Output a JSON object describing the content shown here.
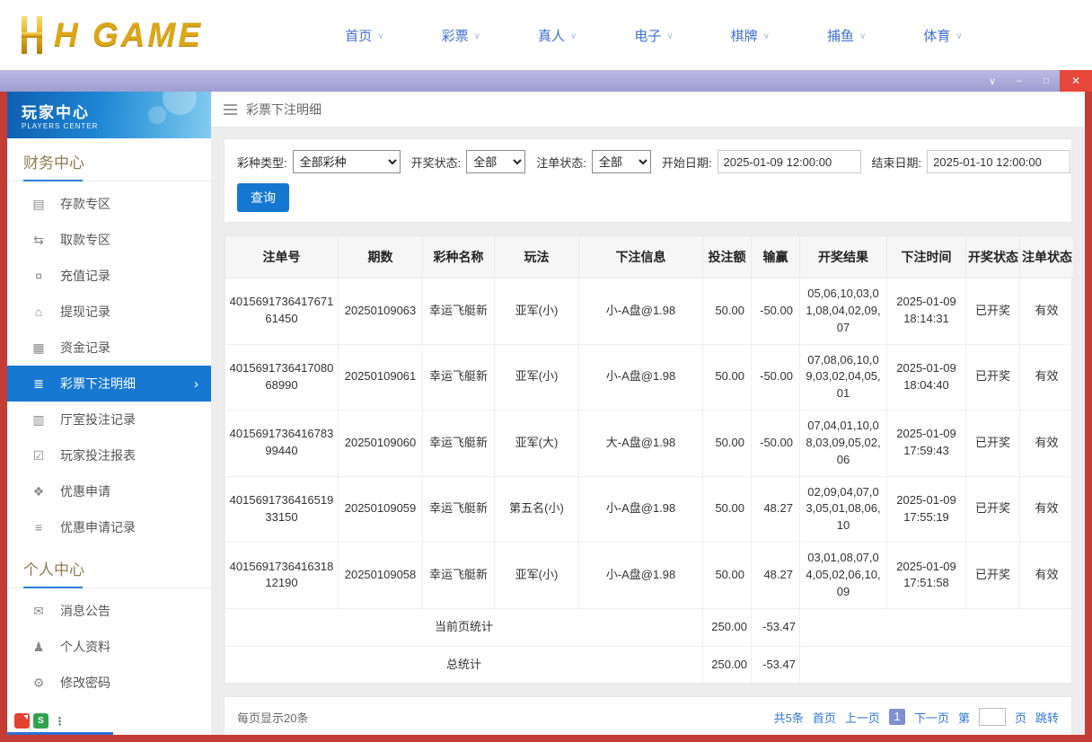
{
  "colors": {
    "accent_blue": "#1677d2",
    "nav_blue": "#3f6fd1",
    "frame_red": "#c43d35",
    "titlebar_lavender": "#aeacd9",
    "close_red": "#e8473b",
    "gold": "#dca619",
    "sidebar_active_blue": "#1778d1"
  },
  "brand": {
    "logo_text": "H GAME"
  },
  "nav": {
    "chevron_glyph": "∨",
    "items": [
      {
        "label": "首页"
      },
      {
        "label": "彩票"
      },
      {
        "label": "真人"
      },
      {
        "label": "电子"
      },
      {
        "label": "棋牌"
      },
      {
        "label": "捕鱼"
      },
      {
        "label": "体育"
      }
    ]
  },
  "titlebar": {
    "controls": [
      {
        "name": "collapse-button",
        "glyph": "∨"
      },
      {
        "name": "minimize-button",
        "glyph": "–"
      },
      {
        "name": "maximize-button",
        "glyph": "□"
      },
      {
        "name": "close-button",
        "glyph": "✕"
      }
    ]
  },
  "sidebar": {
    "title": "玩家中心",
    "subtitle": "PLAYERS CENTER",
    "active_chevron": "›",
    "pinned": {
      "s_glyph": "S",
      "more_glyph": "⋮"
    },
    "sections": [
      {
        "title": "财务中心",
        "items": [
          {
            "label": "存款专区",
            "icon": "▤",
            "icon_name": "deposit-icon"
          },
          {
            "label": "取款专区",
            "icon": "⇆",
            "icon_name": "withdraw-icon"
          },
          {
            "label": "充值记录",
            "icon": "¤",
            "icon_name": "recharge-record-icon"
          },
          {
            "label": "提现记录",
            "icon": "⌂",
            "icon_name": "withdrawal-record-icon"
          },
          {
            "label": "资金记录",
            "icon": "▦",
            "icon_name": "funds-record-icon"
          },
          {
            "label": "彩票下注明细",
            "icon": "≣",
            "icon_name": "lottery-bet-details-icon",
            "active": true
          },
          {
            "label": "厅室投注记录",
            "icon": "▥",
            "icon_name": "hall-bet-record-icon"
          },
          {
            "label": "玩家投注报表",
            "icon": "☑",
            "icon_name": "player-report-icon"
          },
          {
            "label": "优惠申请",
            "icon": "❖",
            "icon_name": "promo-apply-icon"
          },
          {
            "label": "优惠申请记录",
            "icon": "≡",
            "icon_name": "promo-record-icon"
          }
        ]
      },
      {
        "title": "个人中心",
        "items": [
          {
            "label": "消息公告",
            "icon": "✉",
            "icon_name": "announcements-icon"
          },
          {
            "label": "个人资料",
            "icon": "♟",
            "icon_name": "profile-icon"
          },
          {
            "label": "修改密码",
            "icon": "⚙",
            "icon_name": "change-password-icon"
          }
        ]
      }
    ]
  },
  "main": {
    "page_title": "彩票下注明细",
    "filters": {
      "lottery_type_label": "彩种类型:",
      "lottery_type_value": "全部彩种",
      "draw_status_label": "开奖状态:",
      "draw_status_value": "全部",
      "bet_status_label": "注单状态:",
      "bet_status_value": "全部",
      "start_date_label": "开始日期:",
      "start_date_value": "2025-01-09 12:00:00",
      "end_date_label": "结束日期:",
      "end_date_value": "2025-01-10 12:00:00",
      "query_button": "查询"
    },
    "table": {
      "headers": [
        "注单号",
        "期数",
        "彩种名称",
        "玩法",
        "下注信息",
        "投注额",
        "输赢",
        "开奖结果",
        "下注时间",
        "开奖状态",
        "注单状态"
      ],
      "rows": [
        [
          "401569173641767161450",
          "20250109063",
          "幸运飞艇新",
          "亚军(小)",
          "小-A盘@1.98",
          "50.00",
          "-50.00",
          "05,06,10,03,01,08,04,02,09,07",
          "2025-01-09 18:14:31",
          "已开奖",
          "有效"
        ],
        [
          "401569173641708068990",
          "20250109061",
          "幸运飞艇新",
          "亚军(小)",
          "小-A盘@1.98",
          "50.00",
          "-50.00",
          "07,08,06,10,09,03,02,04,05,01",
          "2025-01-09 18:04:40",
          "已开奖",
          "有效"
        ],
        [
          "401569173641678399440",
          "20250109060",
          "幸运飞艇新",
          "亚军(大)",
          "大-A盘@1.98",
          "50.00",
          "-50.00",
          "07,04,01,10,08,03,09,05,02,06",
          "2025-01-09 17:59:43",
          "已开奖",
          "有效"
        ],
        [
          "401569173641651933150",
          "20250109059",
          "幸运飞艇新",
          "第五名(小)",
          "小-A盘@1.98",
          "50.00",
          "48.27",
          "02,09,04,07,03,05,01,08,06,10",
          "2025-01-09 17:55:19",
          "已开奖",
          "有效"
        ],
        [
          "401569173641631812190",
          "20250109058",
          "幸运飞艇新",
          "亚军(小)",
          "小-A盘@1.98",
          "50.00",
          "48.27",
          "03,01,08,07,04,05,02,06,10,09",
          "2025-01-09 17:51:58",
          "已开奖",
          "有效"
        ]
      ],
      "summary_rows": [
        {
          "label": "当前页统计",
          "bet_amount": "250.00",
          "win_loss": "-53.47"
        },
        {
          "label": "总统计",
          "bet_amount": "250.00",
          "win_loss": "-53.47"
        }
      ]
    },
    "pagination": {
      "per_page": "每页显示20条",
      "total": "共5条",
      "first": "首页",
      "prev": "上一页",
      "current_page": "1",
      "next": "下一页",
      "jump_prefix": "第",
      "jump_suffix": "页",
      "jump": "跳转"
    }
  }
}
